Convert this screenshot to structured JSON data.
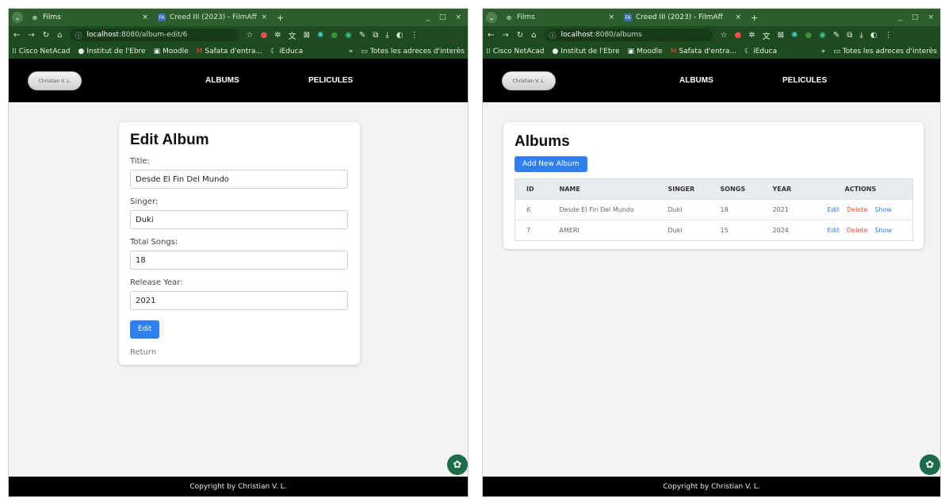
{
  "left": {
    "tabs": [
      {
        "title": "Films",
        "icon": "globe-icon"
      },
      {
        "title": "Creed III (2023) - FilmAff",
        "icon": "filmaffinity-icon",
        "icon_text": "FA"
      }
    ],
    "url_host": "localhost",
    "url_path": ":8080/album-edit/6",
    "page": {
      "nav": {
        "user": "Christian V. L.",
        "albums": "ALBUMS",
        "pelicules": "PELICULES"
      },
      "form": {
        "title": "Edit Album",
        "fields": [
          {
            "label": "Title:",
            "value": "Desde El Fin Del Mundo"
          },
          {
            "label": "Singer:",
            "value": "Duki"
          },
          {
            "label": "Total Songs:",
            "value": "18"
          },
          {
            "label": "Release Year:",
            "value": "2021"
          }
        ],
        "submit": "Edit",
        "return": "Return"
      },
      "footer": "Copyright by Christian V. L."
    }
  },
  "right": {
    "tabs": [
      {
        "title": "Films",
        "icon": "globe-icon"
      },
      {
        "title": "Creed III (2023) - FilmAff",
        "icon": "filmaffinity-icon",
        "icon_text": "FA"
      }
    ],
    "url_host": "localhost",
    "url_path": ":8080/albums",
    "page": {
      "nav": {
        "user": "Christian V. L.",
        "albums": "ALBUMS",
        "pelicules": "PELICULES"
      },
      "title": "Albums",
      "add_button": "Add New Album",
      "table": {
        "headers": [
          "ID",
          "NAME",
          "SINGER",
          "SONGS",
          "YEAR",
          "ACTIONS"
        ],
        "rows": [
          {
            "id": "6",
            "name": "Desde El Fin Del Mundo",
            "singer": "Duki",
            "songs": "18",
            "year": "2021"
          },
          {
            "id": "7",
            "name": "AMERI",
            "singer": "Duki",
            "songs": "15",
            "year": "2024"
          }
        ],
        "actions": {
          "edit": "Edit",
          "delete": "Delete",
          "show": "Show"
        }
      },
      "footer": "Copyright by Christian V. L."
    }
  },
  "bookmarks": {
    "items": [
      "Cisco NetAcad",
      "Institut de l'Ebre",
      "Moodle",
      "Safata d'entra...",
      "iEduca"
    ],
    "overflow": "»",
    "folder": "Totes les adreces d'interès"
  },
  "window_controls": {
    "minimize": "_",
    "maximize": "□",
    "close": "×"
  },
  "colors": {
    "tab_bar": "#2c5f2d",
    "toolbar": "#1e4a20",
    "app_nav": "#000000",
    "primary": "#2f80ed",
    "danger": "#e74c3c"
  }
}
